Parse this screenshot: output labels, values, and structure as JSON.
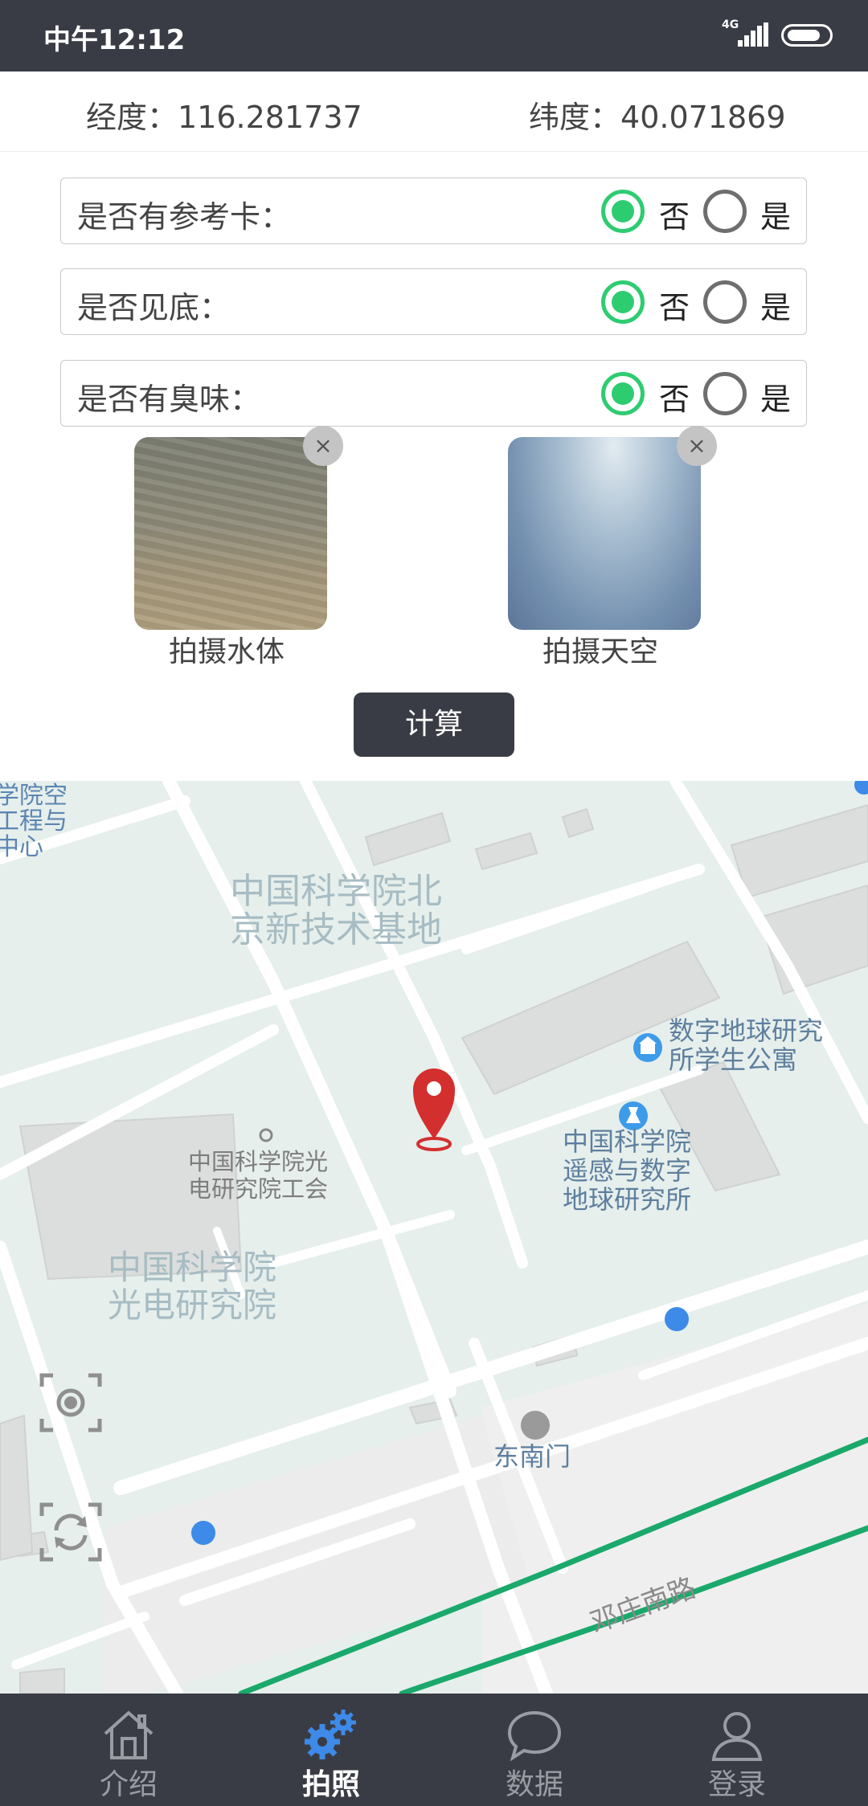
{
  "status_bar": {
    "time": "中午12:12",
    "network": "4G"
  },
  "location": {
    "longitude_label": "经度：",
    "longitude": "116.281737",
    "latitude_label": "纬度：",
    "latitude": "40.071869"
  },
  "questions": [
    {
      "label": "是否有参考卡：",
      "no": "否",
      "yes": "是",
      "selected": "否"
    },
    {
      "label": "是否见底：",
      "no": "否",
      "yes": "是",
      "selected": "否"
    },
    {
      "label": "是否有臭味：",
      "no": "否",
      "yes": "是",
      "selected": "否"
    }
  ],
  "photos": [
    {
      "label": "拍摄水体",
      "close": "×"
    },
    {
      "label": "拍摄天空",
      "close": "×"
    }
  ],
  "calculate_label": "计算",
  "map": {
    "labels": {
      "casc_north": "中国科学院北 京新技术基地",
      "casc_north_1": "中国科学院北",
      "casc_north_2": "京新技术基地",
      "edge_1": "学院空",
      "edge_2": "工程与",
      "edge_3": "中心",
      "dorm_1": "数字地球研究",
      "dorm_2": "所学生公寓",
      "radi_1": "中国科学院",
      "radi_2": "遥感与数字",
      "radi_3": "地球研究所",
      "union_1": "中国科学院光",
      "union_2": "电研究院工会",
      "aoe_1": "中国科学院",
      "aoe_2": "光电研究院",
      "southeast_gate": "东南门",
      "road": "邓庄南路"
    },
    "route_color": "#1aa96b",
    "marker_color": "#d32f2f"
  },
  "nav": {
    "items": [
      {
        "label": "介绍",
        "icon": "home-icon",
        "active": false
      },
      {
        "label": "拍照",
        "icon": "gears-icon",
        "active": true
      },
      {
        "label": "数据",
        "icon": "chat-bubble-icon",
        "active": false
      },
      {
        "label": "登录",
        "icon": "user-icon",
        "active": false
      }
    ]
  }
}
